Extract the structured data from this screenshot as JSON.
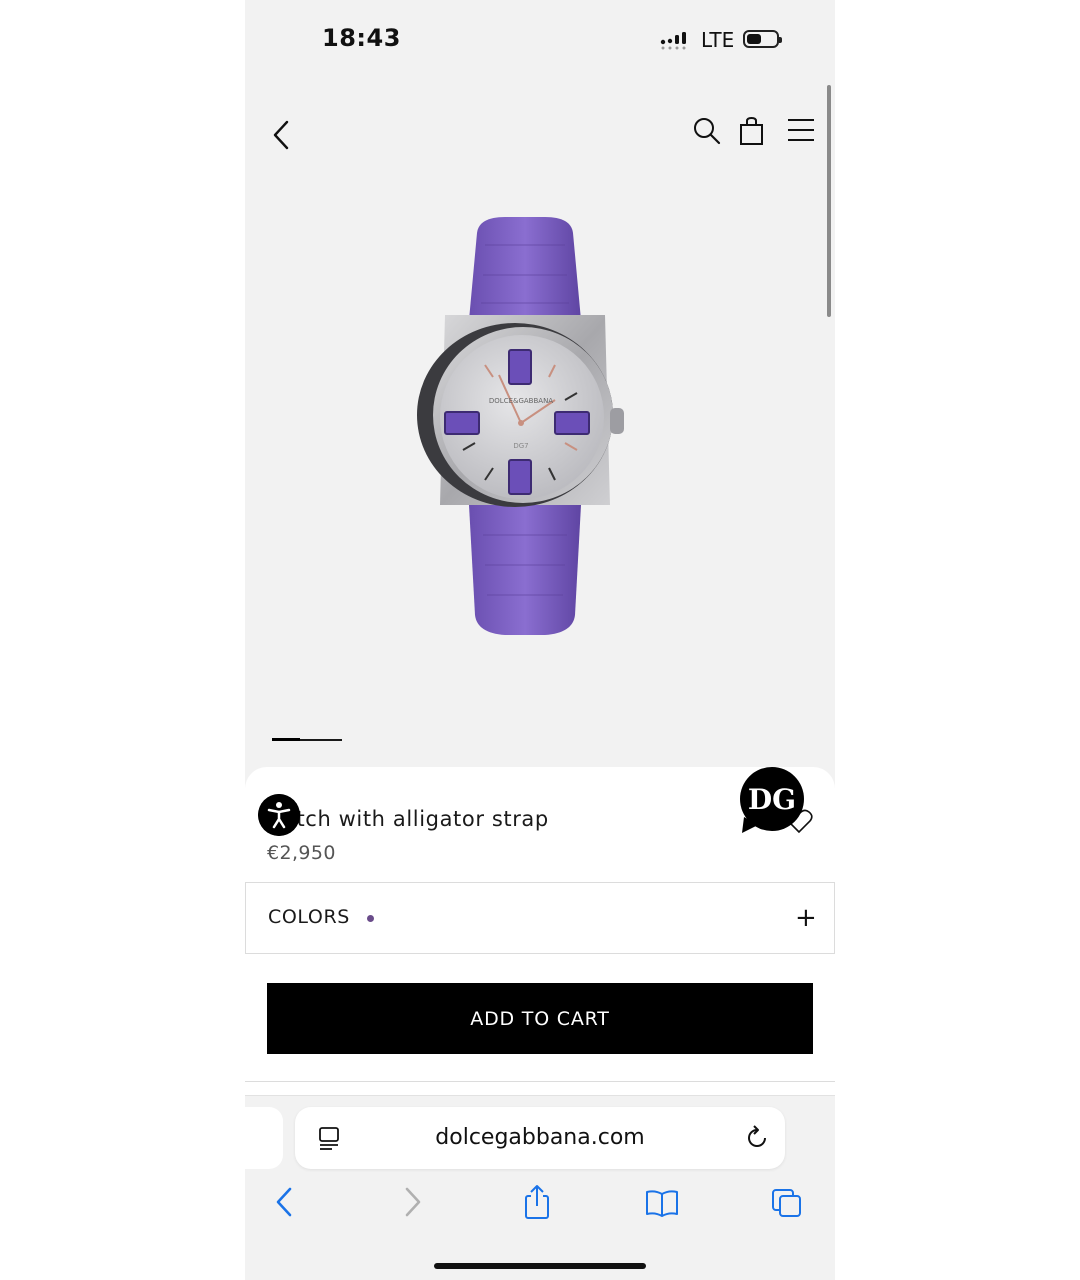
{
  "status_bar": {
    "time": "18:43",
    "network": "LTE"
  },
  "product": {
    "name": "Watch with alligator strap",
    "name_visible": "atch with alligator strap",
    "price": "€2,950",
    "image_dial_brand": "DOLCE&GABBANA",
    "image_dial_model": "DG7"
  },
  "colors": {
    "label": "COLORS",
    "swatch_color": "#6a4c8a",
    "expand_symbol": "+"
  },
  "cart": {
    "add_label": "ADD TO CART"
  },
  "chat": {
    "logo_text": "DG"
  },
  "browser": {
    "url": "dolcegabbana.com"
  },
  "icons": [
    "back-arrow-icon",
    "search-icon",
    "shopping-bag-icon",
    "hamburger-menu-icon",
    "accessibility-icon",
    "heart-icon",
    "dg-chat-icon",
    "reader-page-icon",
    "reload-icon",
    "back-icon",
    "forward-icon",
    "share-icon",
    "bookmarks-icon",
    "tabs-icon"
  ],
  "carousel": {
    "active_index": 1,
    "total": 3
  }
}
